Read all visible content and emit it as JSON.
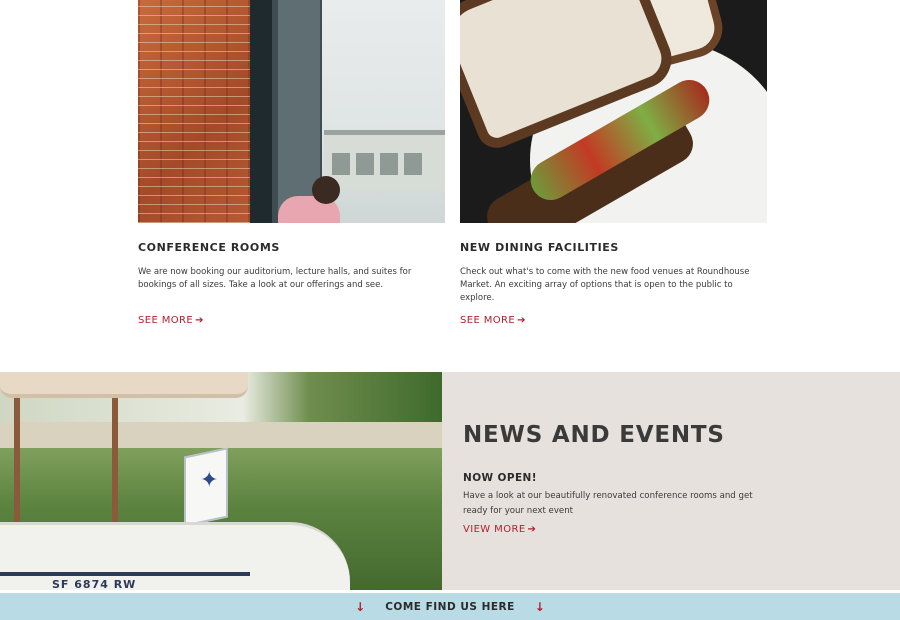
{
  "cards": [
    {
      "title": "CONFERENCE ROOMS",
      "text": "We are now booking our auditorium, lecture halls, and suites for bookings of all sizes. Take a look at our offerings and see.",
      "link_label": "SEE MORE",
      "link_icon": "arrow-right-icon"
    },
    {
      "title": "NEW DINING FACILITIES",
      "text": "Check out what's to come with the new food venues at Roundhouse Market. An exciting array of options that is open to the public to explore.",
      "link_label": "SEE MORE",
      "link_icon": "arrow-right-icon"
    }
  ],
  "news": {
    "heading": "NEWS AND EVENTS",
    "subheading": "NOW OPEN!",
    "text": "Have a look at our beautifully renovated conference rooms and get ready for your next event",
    "link_label": "VIEW MORE",
    "boat_id": "SF 6874 RW"
  },
  "footer": {
    "label": "COME FIND US HERE",
    "icon": "arrow-down-icon"
  },
  "colors": {
    "accent": "#b3202e",
    "panel_bg": "#e6e1dd",
    "footer_bg": "#b8dbe6",
    "text": "#2b2b2b"
  }
}
